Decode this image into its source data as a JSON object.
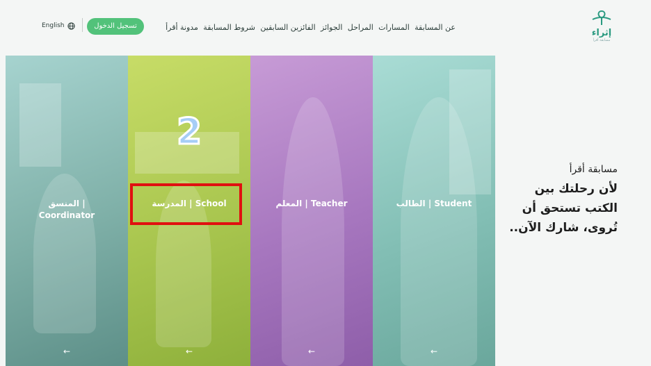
{
  "header": {
    "logo_text": "إثراء",
    "logo_sub": "مسابقة أقرأ",
    "nav": [
      "عن المسابقة",
      "المسارات",
      "المراحل",
      "الجوائز",
      "الفائزين السابقين",
      "شروط المسابقة",
      "مدونة أقرأ"
    ],
    "login_label": "تسجيل الدخول",
    "language_label": "English"
  },
  "panels": {
    "coordinator": {
      "label": "المنسق |",
      "label2": "Coordinator",
      "arrow": "←"
    },
    "school": {
      "label": "المدرسة | School",
      "arrow": "←"
    },
    "teacher": {
      "label": "المعلم | Teacher",
      "arrow": "←"
    },
    "student": {
      "label": "الطالب | Student",
      "arrow": "←"
    }
  },
  "annotation": {
    "number": "2"
  },
  "hero": {
    "small": "مسابقة أقرأ",
    "line1": "لأن رحلتك بين",
    "line2": "الكتب تستحق أن",
    "line3": "تُروى، شارك الآن.."
  }
}
